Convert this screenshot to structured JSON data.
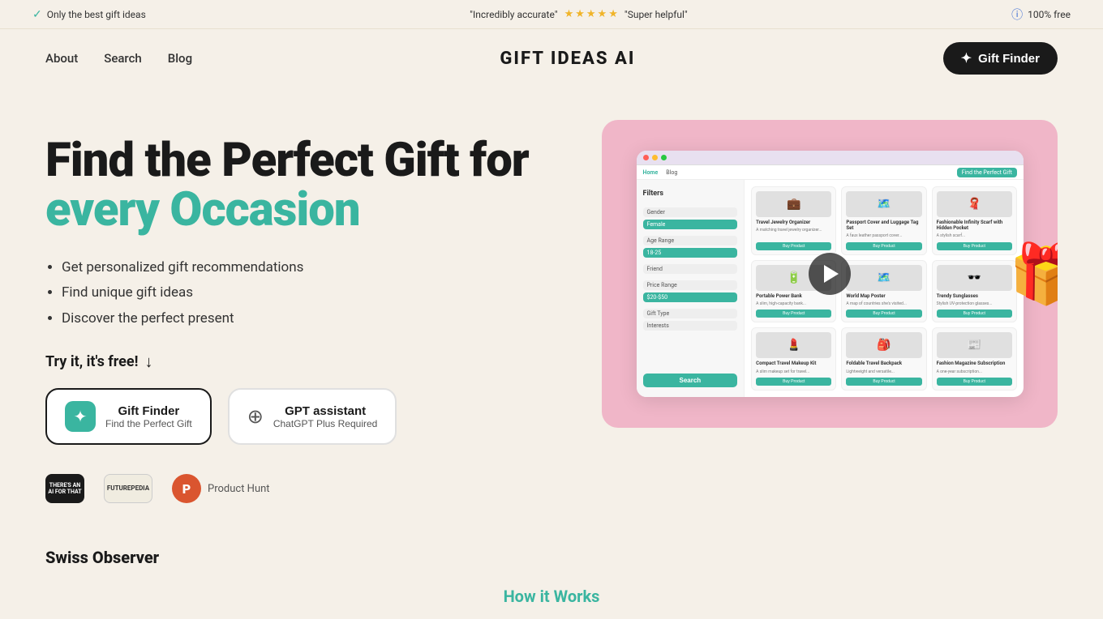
{
  "topbar": {
    "left_text": "Only the best gift ideas",
    "center_quote": "\"Incredibly accurate\"",
    "center_rating": "\"Super helpful\"",
    "right_text": "100% free",
    "stars": [
      "★",
      "★",
      "★",
      "★",
      "★"
    ]
  },
  "navbar": {
    "links": [
      {
        "label": "About",
        "href": "#"
      },
      {
        "label": "Search",
        "href": "#"
      },
      {
        "label": "Blog",
        "href": "#"
      }
    ],
    "logo": "GIFT IDEAS AI",
    "cta_button": "Gift Finder"
  },
  "hero": {
    "title_line1": "Find the Perfect Gift for",
    "title_line2": "every Occasion",
    "bullets": [
      "Get personalized gift recommendations",
      "Find unique gift ideas",
      "Discover the perfect present"
    ],
    "cta_text": "Try it, it's free!",
    "buttons": [
      {
        "label": "Gift Finder",
        "sublabel": "Find the Perfect Gift",
        "type": "gift-finder"
      },
      {
        "label": "GPT assistant",
        "sublabel": "ChatGPT Plus Required",
        "type": "gpt"
      }
    ],
    "badges": [
      {
        "label": "THERE'S AN AI FOR THAT",
        "type": "dark"
      },
      {
        "label": "FUTUREPEDIA",
        "type": "light"
      },
      {
        "label": "P",
        "text": "Product Hunt",
        "type": "ph"
      }
    ]
  },
  "swiss_observer": "Swiss Observer",
  "screenshot": {
    "filters_label": "Filters",
    "filters": [
      {
        "label": "Gender",
        "active": false
      },
      {
        "label": "Female",
        "active": true
      },
      {
        "label": "Age Range",
        "active": false
      },
      {
        "label": "18-25",
        "active": true
      },
      {
        "label": "Friend",
        "active": false
      },
      {
        "label": "Price Range",
        "active": false
      },
      {
        "label": "$20-$50",
        "active": true
      },
      {
        "label": "Gift Type",
        "active": false
      },
      {
        "label": "Interests",
        "active": false
      }
    ],
    "search_btn": "Search",
    "cards": [
      {
        "emoji": "💼",
        "title": "Travel Jewelry Organizer",
        "desc": "A matching travel jewelry..."
      },
      {
        "emoji": "🗺️",
        "title": "Passport Cover and Luggage Tag Set",
        "desc": "A faux leather passport cover..."
      },
      {
        "emoji": "🧣",
        "title": "Fashionable Infinity Scarf with Hidden Pocket",
        "desc": "A stylish scarf that..."
      },
      {
        "emoji": "🔋",
        "title": "Portable Power Bank",
        "desc": "A slim, high-capacity bank..."
      },
      {
        "emoji": "🗺️",
        "title": "World Map Poster",
        "desc": "A map of the countries she has visited..."
      },
      {
        "emoji": "🕶️",
        "title": "Trendy Sunglasses",
        "desc": "Stylish UV-protection glasses..."
      },
      {
        "emoji": "💄",
        "title": "Compact Travel Makeup Kit",
        "desc": "A slim makeup set..."
      },
      {
        "emoji": "🎒",
        "title": "Foldable Travel Backpack",
        "desc": "Lightweight and versatile..."
      },
      {
        "emoji": "📰",
        "title": "Fashion Magazine Subscription",
        "desc": "A one-year subscription..."
      }
    ],
    "nav_items": [
      "Home",
      "Blog"
    ],
    "nav_cta": "Find the Perfect Gift"
  },
  "how_it_works": "How it Works"
}
